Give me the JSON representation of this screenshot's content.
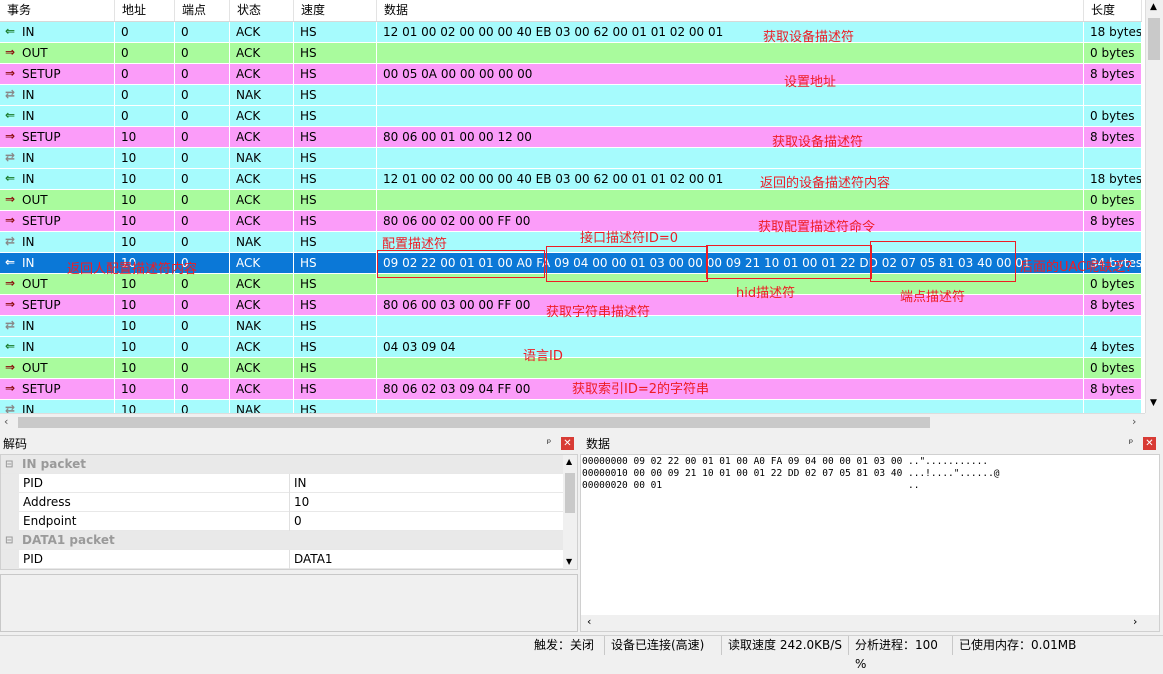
{
  "columns": [
    "事务",
    "地址",
    "端点",
    "状态",
    "速度",
    "数据",
    "长度"
  ],
  "rows": [
    {
      "type": "IN",
      "dir": "in",
      "addr": "0",
      "ep": "0",
      "status": "ACK",
      "speed": "HS",
      "data": "12 01 00 02 00 00 00 40 EB 03 00 62 00 01 01 02 00 01",
      "len": "18 bytes",
      "color": "in"
    },
    {
      "type": "OUT",
      "dir": "out",
      "addr": "0",
      "ep": "0",
      "status": "ACK",
      "speed": "HS",
      "data": "",
      "len": "0 bytes",
      "color": "out"
    },
    {
      "type": "SETUP",
      "dir": "out",
      "addr": "0",
      "ep": "0",
      "status": "ACK",
      "speed": "HS",
      "data": "00 05 0A 00 00 00 00 00",
      "len": "8 bytes",
      "color": "setup"
    },
    {
      "type": "IN",
      "dir": "nak",
      "addr": "0",
      "ep": "0",
      "status": "NAK",
      "speed": "HS",
      "data": "",
      "len": "",
      "color": "in"
    },
    {
      "type": "IN",
      "dir": "in",
      "addr": "0",
      "ep": "0",
      "status": "ACK",
      "speed": "HS",
      "data": "",
      "len": "0 bytes",
      "color": "in"
    },
    {
      "type": "SETUP",
      "dir": "out",
      "addr": "10",
      "ep": "0",
      "status": "ACK",
      "speed": "HS",
      "data": "80 06 00 01 00 00 12 00",
      "len": "8 bytes",
      "color": "setup"
    },
    {
      "type": "IN",
      "dir": "nak",
      "addr": "10",
      "ep": "0",
      "status": "NAK",
      "speed": "HS",
      "data": "",
      "len": "",
      "color": "in"
    },
    {
      "type": "IN",
      "dir": "in",
      "addr": "10",
      "ep": "0",
      "status": "ACK",
      "speed": "HS",
      "data": "12 01 00 02 00 00 00 40 EB 03 00 62 00 01 01 02 00 01",
      "len": "18 bytes",
      "color": "in"
    },
    {
      "type": "OUT",
      "dir": "out",
      "addr": "10",
      "ep": "0",
      "status": "ACK",
      "speed": "HS",
      "data": "",
      "len": "0 bytes",
      "color": "out"
    },
    {
      "type": "SETUP",
      "dir": "out",
      "addr": "10",
      "ep": "0",
      "status": "ACK",
      "speed": "HS",
      "data": "80 06 00 02 00 00 FF 00",
      "len": "8 bytes",
      "color": "setup"
    },
    {
      "type": "IN",
      "dir": "nak",
      "addr": "10",
      "ep": "0",
      "status": "NAK",
      "speed": "HS",
      "data": "",
      "len": "",
      "color": "in"
    },
    {
      "type": "IN",
      "dir": "in",
      "addr": "10",
      "ep": "0",
      "status": "ACK",
      "speed": "HS",
      "data": "09 02 22 00 01 01 00 A0 FA 09 04 00 00 01 03 00 00 00 09 21 10 01 00 01 22 DD 02 07 05 81 03 40 00 01",
      "len": "34 bytes",
      "color": "sel"
    },
    {
      "type": "OUT",
      "dir": "out",
      "addr": "10",
      "ep": "0",
      "status": "ACK",
      "speed": "HS",
      "data": "",
      "len": "0 bytes",
      "color": "out"
    },
    {
      "type": "SETUP",
      "dir": "out",
      "addr": "10",
      "ep": "0",
      "status": "ACK",
      "speed": "HS",
      "data": "80 06 00 03 00 00 FF 00",
      "len": "8 bytes",
      "color": "setup"
    },
    {
      "type": "IN",
      "dir": "nak",
      "addr": "10",
      "ep": "0",
      "status": "NAK",
      "speed": "HS",
      "data": "",
      "len": "",
      "color": "in"
    },
    {
      "type": "IN",
      "dir": "in",
      "addr": "10",
      "ep": "0",
      "status": "ACK",
      "speed": "HS",
      "data": "04 03 09 04",
      "len": "4 bytes",
      "color": "in"
    },
    {
      "type": "OUT",
      "dir": "out",
      "addr": "10",
      "ep": "0",
      "status": "ACK",
      "speed": "HS",
      "data": "",
      "len": "0 bytes",
      "color": "out"
    },
    {
      "type": "SETUP",
      "dir": "out",
      "addr": "10",
      "ep": "0",
      "status": "ACK",
      "speed": "HS",
      "data": "80 06 02 03 09 04 FF 00",
      "len": "8 bytes",
      "color": "setup"
    },
    {
      "type": "IN",
      "dir": "nak",
      "addr": "10",
      "ep": "0",
      "status": "NAK",
      "speed": "HS",
      "data": "",
      "len": "",
      "color": "in"
    }
  ],
  "annotations": {
    "a1": "获取设备描述符",
    "a2": "设置地址",
    "a3": "获取设备描述符",
    "a4": "返回的设备描述符内容",
    "a5": "获取配置描述符命令",
    "a6": "配置描述符",
    "a7": "接口描述符ID=0",
    "a8": "返回人配置描述符内容",
    "a9": "hid描述符",
    "a10": "端点描述符",
    "a11": "后面的UAC呢缺乏？",
    "a12": "获取字符串描述符",
    "a13": "语言ID",
    "a14": "获取索引ID=2的字符串"
  },
  "decode": {
    "title": "解码",
    "groups": [
      {
        "name": "IN packet",
        "props": [
          {
            "k": "PID",
            "v": "IN"
          },
          {
            "k": "Address",
            "v": "10"
          },
          {
            "k": "Endpoint",
            "v": "0"
          }
        ]
      },
      {
        "name": "DATA1 packet",
        "props": [
          {
            "k": "PID",
            "v": "DATA1"
          }
        ]
      }
    ]
  },
  "datapanel": {
    "title": "数据",
    "lines": [
      "00000000 09 02 22 00 01 01 00 A0 FA 09 04 00 00 01 03 00 ..\"...........",
      "00000010 00 00 09 21 10 01 00 01 22 DD 02 07 05 81 03 40 ...!....\"......@",
      "00000020 00 01                                           .."
    ]
  },
  "statusbar": {
    "trigger": "触发：关闭",
    "device": "设备已连接(高速)",
    "speed": "读取速度 242.0KB/S",
    "progress": "分析进程：100 %",
    "memory": "已使用内存：0.01MB"
  },
  "colors": {
    "in": "#a6fbfd",
    "out": "#a9fb9d",
    "setup": "#fb9cf9",
    "selected": "#0b78d7",
    "annotation": "#ee1c24"
  }
}
